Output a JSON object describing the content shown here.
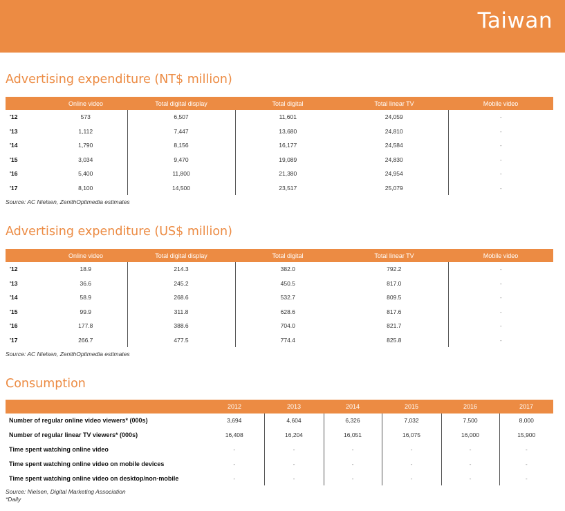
{
  "banner": {
    "title": "Taiwan"
  },
  "section1": {
    "title": "Advertising expenditure (NT$ million)",
    "columns": [
      "Online video",
      "Total digital display",
      "Total digital",
      "Total linear TV",
      "Mobile video"
    ],
    "rows": [
      {
        "year": "'12",
        "values": [
          "573",
          "6,507",
          "11,601",
          "24,059",
          "-"
        ]
      },
      {
        "year": "'13",
        "values": [
          "1,112",
          "7,447",
          "13,680",
          "24,810",
          "-"
        ]
      },
      {
        "year": "'14",
        "values": [
          "1,790",
          "8,156",
          "16,177",
          "24,584",
          "-"
        ]
      },
      {
        "year": "'15",
        "values": [
          "3,034",
          "9,470",
          "19,089",
          "24,830",
          "-"
        ]
      },
      {
        "year": "'16",
        "values": [
          "5,400",
          "11,800",
          "21,380",
          "24,954",
          "-"
        ]
      },
      {
        "year": "'17",
        "values": [
          "8,100",
          "14,500",
          "23,517",
          "25,079",
          "-"
        ]
      }
    ],
    "source": "Source: AC Nielsen, ZenithOptimedia estimates"
  },
  "section2": {
    "title": "Advertising expenditure (US$ million)",
    "columns": [
      "Online video",
      "Total digital display",
      "Total digital",
      "Total linear TV",
      "Mobile video"
    ],
    "rows": [
      {
        "year": "'12",
        "values": [
          "18.9",
          "214.3",
          "382.0",
          "792.2",
          "-"
        ]
      },
      {
        "year": "'13",
        "values": [
          "36.6",
          "245.2",
          "450.5",
          "817.0",
          "-"
        ]
      },
      {
        "year": "'14",
        "values": [
          "58.9",
          "268.6",
          "532.7",
          "809.5",
          "-"
        ]
      },
      {
        "year": "'15",
        "values": [
          "99.9",
          "311.8",
          "628.6",
          "817.6",
          "-"
        ]
      },
      {
        "year": "'16",
        "values": [
          "177.8",
          "388.6",
          "704.0",
          "821.7",
          "-"
        ]
      },
      {
        "year": "'17",
        "values": [
          "266.7",
          "477.5",
          "774.4",
          "825.8",
          "-"
        ]
      }
    ],
    "source": "Source: AC Nielsen, ZenithOptimedia estimates"
  },
  "consumption": {
    "title": "Consumption",
    "years": [
      "2012",
      "2013",
      "2014",
      "2015",
      "2016",
      "2017"
    ],
    "rows": [
      {
        "label": "Number of regular online video viewers* (000s)",
        "values": [
          "3,694",
          "4,604",
          "6,326",
          "7,032",
          "7,500",
          "8,000"
        ]
      },
      {
        "label": "Number of regular linear TV viewers* (000s)",
        "values": [
          "16,408",
          "16,204",
          "16,051",
          "16,075",
          "16,000",
          "15,900"
        ]
      },
      {
        "label": "Time spent watching online video",
        "values": [
          "-",
          "-",
          "-",
          "-",
          "-",
          "-"
        ]
      },
      {
        "label": "Time spent watching online video on mobile devices",
        "values": [
          "-",
          "-",
          "-",
          "-",
          "-",
          "-"
        ]
      },
      {
        "label": "Time spent watching online video on desktop/non-mobile",
        "values": [
          "-",
          "-",
          "-",
          "-",
          "-",
          "-"
        ]
      }
    ],
    "source": "Source: Nielsen, Digital Marketing Association",
    "footnote": "*Daily"
  }
}
